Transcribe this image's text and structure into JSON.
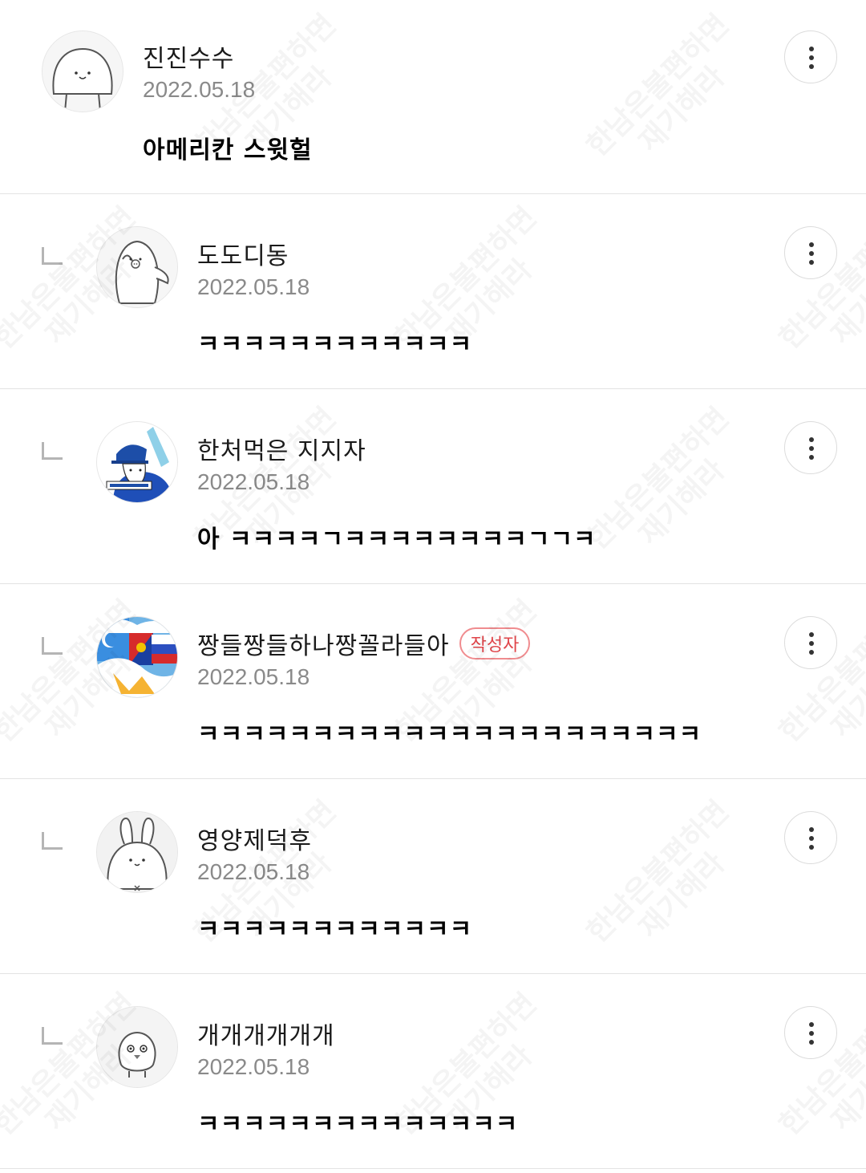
{
  "comments": [
    {
      "nickname": "진진수수",
      "date": "2022.05.18",
      "text": "아메리칸 스윗헐",
      "avatar_icon": "round-cat-face-icon",
      "is_reply": false
    },
    {
      "nickname": "도도디동",
      "date": "2022.05.18",
      "text": "ㅋㅋㅋㅋㅋㅋㅋㅋㅋㅋㅋㅋ",
      "avatar_icon": "penguin-icon",
      "is_reply": true
    },
    {
      "nickname": "한처먹은 지지자",
      "date": "2022.05.18",
      "text": "아 ㅋㅋㅋㅋㄱㅋㅋㅋㅋㅋㅋㅋㅋㄱㄱㅋ",
      "avatar_icon": "blue-cap-character-photo",
      "is_reply": true
    },
    {
      "nickname": "짱들짱들하나짱꼴라들아",
      "badge": "작성자",
      "date": "2022.05.18",
      "text": "ㅋㅋㅋㅋㅋㅋㅋㅋㅋㅋㅋㅋㅋㅋㅋㅋㅋㅋㅋㅋㅋㅋ",
      "avatar_icon": "flags-collage-photo",
      "is_reply": true
    },
    {
      "nickname": "영양제덕후",
      "date": "2022.05.18",
      "text": "ㅋㅋㅋㅋㅋㅋㅋㅋㅋㅋㅋㅋ",
      "avatar_icon": "rabbit-icon",
      "is_reply": true
    },
    {
      "nickname": "개개개개개개",
      "date": "2022.05.18",
      "text": "ㅋㅋㅋㅋㅋㅋㅋㅋㅋㅋㅋㅋㅋㅋ",
      "avatar_icon": "chick-icon",
      "is_reply": true
    }
  ],
  "watermark": {
    "line1": "한남은불편하면",
    "line2": "재기해라"
  },
  "colors": {
    "badge": "#e0454a",
    "date": "#8a8a8a",
    "divider": "#e3e3e3"
  }
}
